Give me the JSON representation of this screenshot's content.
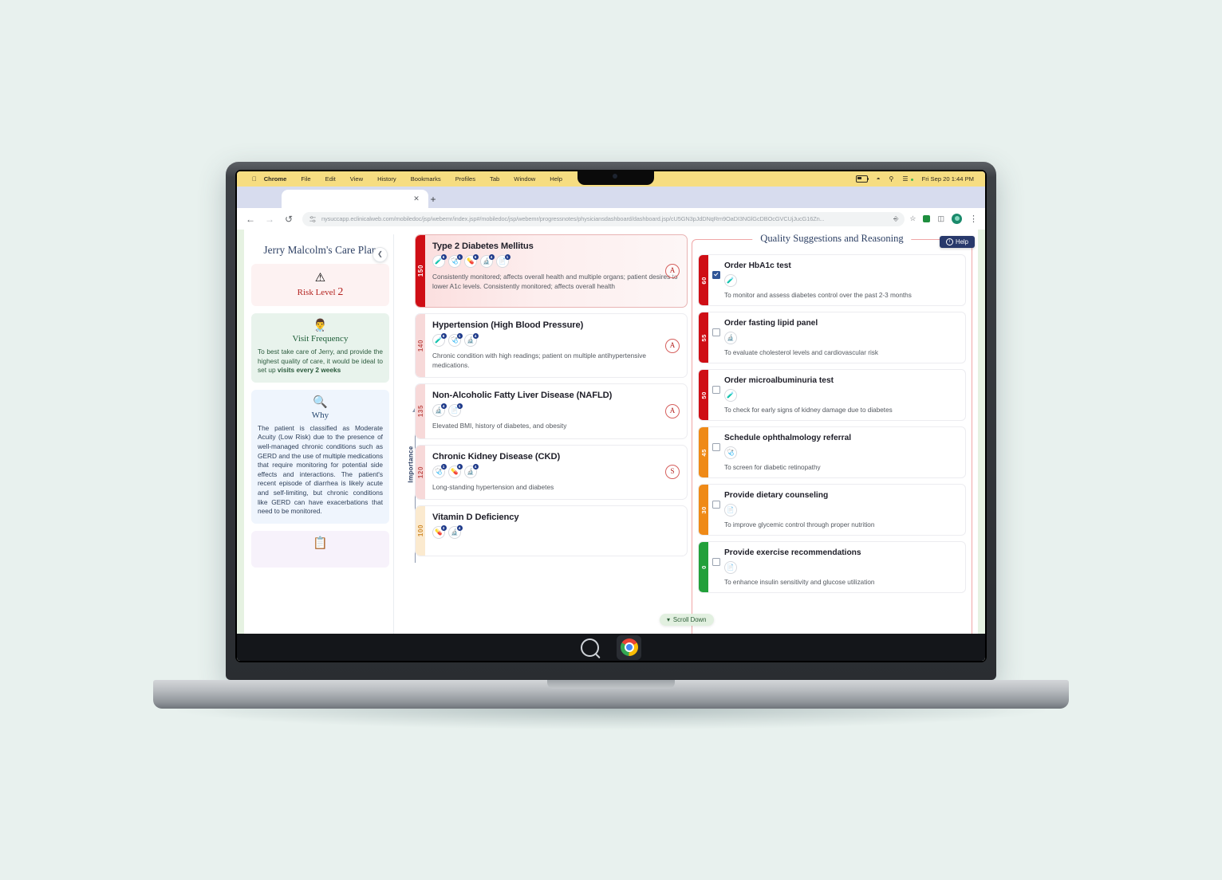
{
  "os": {
    "menubar": {
      "apple_icon": "apple-icon",
      "items": [
        "Chrome",
        "File",
        "Edit",
        "View",
        "History",
        "Bookmarks",
        "Profiles",
        "Tab",
        "Window",
        "Help"
      ],
      "status": {
        "battery_icon": "battery-icon",
        "wifi_icon": "wifi-icon",
        "search_icon": "search-icon",
        "control_center_icon": "control-center-icon",
        "datetime": "Fri Sep 20  1:44 PM"
      }
    },
    "dock": {
      "search_icon": "dock-search-icon",
      "chrome_icon": "chrome-icon"
    }
  },
  "browser": {
    "tab": {
      "title": "",
      "close_icon": "close-icon"
    },
    "new_tab_icon": "plus-icon",
    "back_icon": "back-arrow-icon",
    "forward_icon": "forward-arrow-icon",
    "reload_icon": "reload-icon",
    "site_settings_icon": "tune-icon",
    "url": "nysuccapp.eclinicalweb.com/mobiledoc/jsp/webemr/index.jsp#/mobiledoc/jsp/webemr/progressnotes/physiciansdashboard/dashboard.jsp/cU5GN3pJdDNqRm9OaDI3NGlGcDBOcGVCUjJucG16Zn...",
    "translate_icon": "translate-icon",
    "bookmark_icon": "star-icon",
    "extension_icon": "extension-icon",
    "sidepanel_icon": "side-panel-icon",
    "profile_icon": "profile-avatar-icon",
    "menu_icon": "kebab-menu-icon"
  },
  "app": {
    "help_button": {
      "label": "Help",
      "icon": "info-icon"
    },
    "scroll_pill": {
      "label": "Scroll Down",
      "icon": "chevron-down-icon"
    },
    "sidebar": {
      "title": "Jerry Malcolm's Care Plan",
      "collapse_icon": "chevron-left-icon",
      "risk": {
        "icon": "warning-triangle-icon",
        "label": "Risk Level",
        "value": "2"
      },
      "visit": {
        "icon": "doctor-icon",
        "heading": "Visit Frequency",
        "body": "To best take care of Jerry, and provide the highest quality of care, it would be ideal to set up ",
        "emphasis": "visits every 2 weeks"
      },
      "why": {
        "icon": "question-person-icon",
        "heading": "Why",
        "body": "The patient is classified as Moderate Acuity (Low Risk) due to the presence of well-managed chronic conditions such as GERD and the use of multiple medications that require monitoring for potential side effects and interactions. The patient's recent episode of diarrhea is likely acute and self-limiting, but chronic conditions like GERD can have exacerbations that need to be monitored."
      },
      "notes": {
        "icon": "clipboard-icon"
      }
    },
    "conditions_axis": {
      "label": "Importance",
      "arrow_icon": "up-arrow-icon"
    },
    "conditions": [
      {
        "score": "150",
        "title": "Type 2 Diabetes Mellitus",
        "desc": "Consistently monitored; affects overall health and multiple organs; patient desires to lower A1c levels.  Consistently monitored; affects overall health",
        "severity": "A",
        "rail_color": "#cf0e15",
        "rail_text_color": "#ffffff",
        "highlighted": true,
        "icons": [
          {
            "name": "lab-test-icon",
            "glyph": "🧪",
            "badge": "6"
          },
          {
            "name": "stethoscope-icon",
            "glyph": "🩺",
            "badge": "1"
          },
          {
            "name": "medical-bag-icon",
            "glyph": "💊",
            "badge": "6"
          },
          {
            "name": "medication-icon",
            "glyph": "🔬",
            "badge": "4"
          },
          {
            "name": "document-icon",
            "glyph": "📄",
            "badge": "1"
          }
        ]
      },
      {
        "score": "140",
        "title": "Hypertension (High Blood Pressure)",
        "desc": "Chronic condition with high readings; patient on multiple antihypertensive medications.",
        "severity": "A",
        "rail_color": "#f7d9d9",
        "rail_text_color": "#c0504d",
        "highlighted": false,
        "icons": [
          {
            "name": "lab-test-icon",
            "glyph": "🧪",
            "badge": "6"
          },
          {
            "name": "stethoscope-icon",
            "glyph": "🩺",
            "badge": "1"
          },
          {
            "name": "medication-icon",
            "glyph": "🔬",
            "badge": "4"
          }
        ]
      },
      {
        "score": "135",
        "title": "Non-Alcoholic Fatty Liver Disease (NAFLD)",
        "desc": "Elevated BMI, history of diabetes, and obesity",
        "severity": "A",
        "rail_color": "#f7d9d9",
        "rail_text_color": "#c0504d",
        "highlighted": false,
        "icons": [
          {
            "name": "medication-icon",
            "glyph": "🔬",
            "badge": "4"
          },
          {
            "name": "document-icon",
            "glyph": "📄",
            "badge": "1"
          }
        ]
      },
      {
        "score": "120",
        "title": "Chronic Kidney Disease (CKD)",
        "desc": "Long-standing hypertension and diabetes",
        "severity": "S",
        "rail_color": "#f7d9d9",
        "rail_text_color": "#c0504d",
        "highlighted": false,
        "icons": [
          {
            "name": "stethoscope-icon",
            "glyph": "🩺",
            "badge": "1"
          },
          {
            "name": "medical-bag-icon",
            "glyph": "💊",
            "badge": "6"
          },
          {
            "name": "medication-icon",
            "glyph": "🔬",
            "badge": "4"
          }
        ]
      },
      {
        "score": "100",
        "title": "Vitamin D Deficiency",
        "desc": "",
        "severity": "",
        "rail_color": "#fbeacf",
        "rail_text_color": "#d08a2a",
        "highlighted": false,
        "icons": [
          {
            "name": "medical-bag-icon",
            "glyph": "💊",
            "badge": "3"
          },
          {
            "name": "medication-icon",
            "glyph": "🔬",
            "badge": "4"
          }
        ]
      }
    ],
    "quality": {
      "title": "Quality Suggestions and Reasoning",
      "items": [
        {
          "score": "60",
          "title": "Order HbA1c test",
          "desc": "To monitor and assess diabetes control over the past 2-3 months",
          "checked": true,
          "rail_color": "#cf0e15",
          "icon": {
            "name": "lab-test-icon",
            "glyph": "🧪"
          }
        },
        {
          "score": "55",
          "title": "Order fasting lipid panel",
          "desc": "To evaluate cholesterol levels and cardiovascular risk",
          "checked": false,
          "rail_color": "#cf0e15",
          "icon": {
            "name": "medication-icon",
            "glyph": "🔬"
          }
        },
        {
          "score": "50",
          "title": "Order microalbuminuria test",
          "desc": "To check for early signs of kidney damage due to diabetes",
          "checked": false,
          "rail_color": "#cf0e15",
          "icon": {
            "name": "lab-test-icon",
            "glyph": "🧪"
          }
        },
        {
          "score": "45",
          "title": "Schedule ophthalmology referral",
          "desc": "To screen for diabetic retinopathy",
          "checked": false,
          "rail_color": "#ef8a17",
          "icon": {
            "name": "stethoscope-icon",
            "glyph": "🩺"
          }
        },
        {
          "score": "30",
          "title": "Provide dietary counseling",
          "desc": "To improve glycemic control through proper nutrition",
          "checked": false,
          "rail_color": "#ef8a17",
          "icon": {
            "name": "document-icon",
            "glyph": "📄"
          }
        },
        {
          "score": "0",
          "title": "Provide exercise recommendations",
          "desc": "To enhance insulin sensitivity and glucose utilization",
          "checked": false,
          "rail_color": "#22a03a",
          "icon": {
            "name": "document-icon",
            "glyph": "📄"
          }
        }
      ]
    }
  },
  "colors": {
    "accent_navy": "#2c3f63",
    "danger_red": "#cf0e15",
    "warn_orange": "#ef8a17",
    "ok_green": "#22a03a",
    "page_bg": "#e8f1ee"
  }
}
